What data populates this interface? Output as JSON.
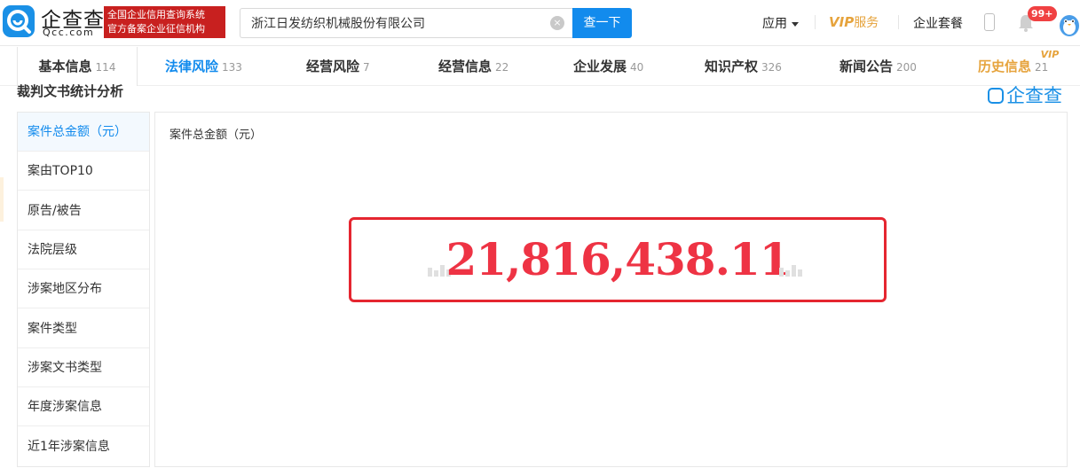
{
  "header": {
    "logo_cn": "企查查",
    "logo_en": "Qcc.com",
    "badge_line1": "全国企业信用查询系统",
    "badge_line2": "官方备案企业征信机构",
    "search_value": "浙江日发纺织机械股份有限公司",
    "search_button": "查一下",
    "nav_app": "应用",
    "nav_vip_mark": "VIP",
    "nav_vip_text": "服务",
    "nav_package": "企业套餐",
    "notification_count": "99+"
  },
  "tabs": [
    {
      "label": "基本信息",
      "count": "114"
    },
    {
      "label": "法律风险",
      "count": "133"
    },
    {
      "label": "经营风险",
      "count": "7"
    },
    {
      "label": "经营信息",
      "count": "22"
    },
    {
      "label": "企业发展",
      "count": "40"
    },
    {
      "label": "知识产权",
      "count": "326"
    },
    {
      "label": "新闻公告",
      "count": "200"
    },
    {
      "label": "历史信息",
      "count": "21",
      "badge": "VIP"
    }
  ],
  "section": {
    "title": "裁判文书统计分析",
    "watermark": "企查查"
  },
  "leftnav": [
    {
      "label": "案件总金额（元）"
    },
    {
      "label": "案由TOP10"
    },
    {
      "label": "原告/被告"
    },
    {
      "label": "法院层级"
    },
    {
      "label": "涉案地区分布"
    },
    {
      "label": "案件类型"
    },
    {
      "label": "涉案文书类型"
    },
    {
      "label": "年度涉案信息"
    },
    {
      "label": "近1年涉案信息"
    }
  ],
  "panel": {
    "label": "案件总金额（元）",
    "amount": "21,816,438.11"
  },
  "colors": {
    "brand_blue": "#128bed",
    "amount_red": "#ee3344",
    "box_red": "#e52630",
    "vip_gold": "#e6a33c"
  }
}
